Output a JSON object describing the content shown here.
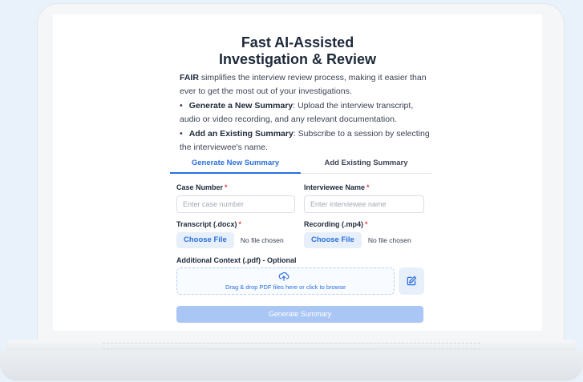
{
  "app": {
    "title_line1": "Fast AI-Assisted",
    "title_line2": "Investigation & Review"
  },
  "intro": {
    "brand": "FAIR",
    "text": " simplifies the interview review process, making it easier than ever to get the most out of your investigations."
  },
  "bullets": [
    {
      "title": "Generate a New Summary",
      "text": ": Upload the interview transcript, audio or video recording, and any relevant documentation."
    },
    {
      "title": "Add an Existing Summary",
      "text": ": Subscribe to a session by selecting the interviewee's name."
    }
  ],
  "tabs": [
    {
      "label": "Generate New Summary",
      "active": true
    },
    {
      "label": "Add Existing Summary",
      "active": false
    }
  ],
  "form": {
    "case_number": {
      "label": "Case Number",
      "required_mark": "*",
      "placeholder": "Enter case number",
      "value": ""
    },
    "interviewee_name": {
      "label": "Interviewee Name",
      "required_mark": "*",
      "placeholder": "Enter interviewee name",
      "value": ""
    },
    "transcript": {
      "label": "Transcript (.docx)",
      "required_mark": "*",
      "button": "Choose File",
      "status": "No file chosen"
    },
    "recording": {
      "label": "Recording (.mp4)",
      "required_mark": "*",
      "button": "Choose File",
      "status": "No file chosen"
    },
    "context": {
      "label": "Additional Context (.pdf) - Optional",
      "dropzone_text": "Drag & drop PDF files here or click to browse"
    },
    "submit_label": "Generate Summary"
  },
  "icons": {
    "upload": "cloud-upload-icon",
    "edit": "edit-icon"
  },
  "colors": {
    "accent": "#2a6fe0",
    "required": "#e5484d",
    "disabled_button": "#a9c6f5",
    "background": "#e9f1fb"
  }
}
